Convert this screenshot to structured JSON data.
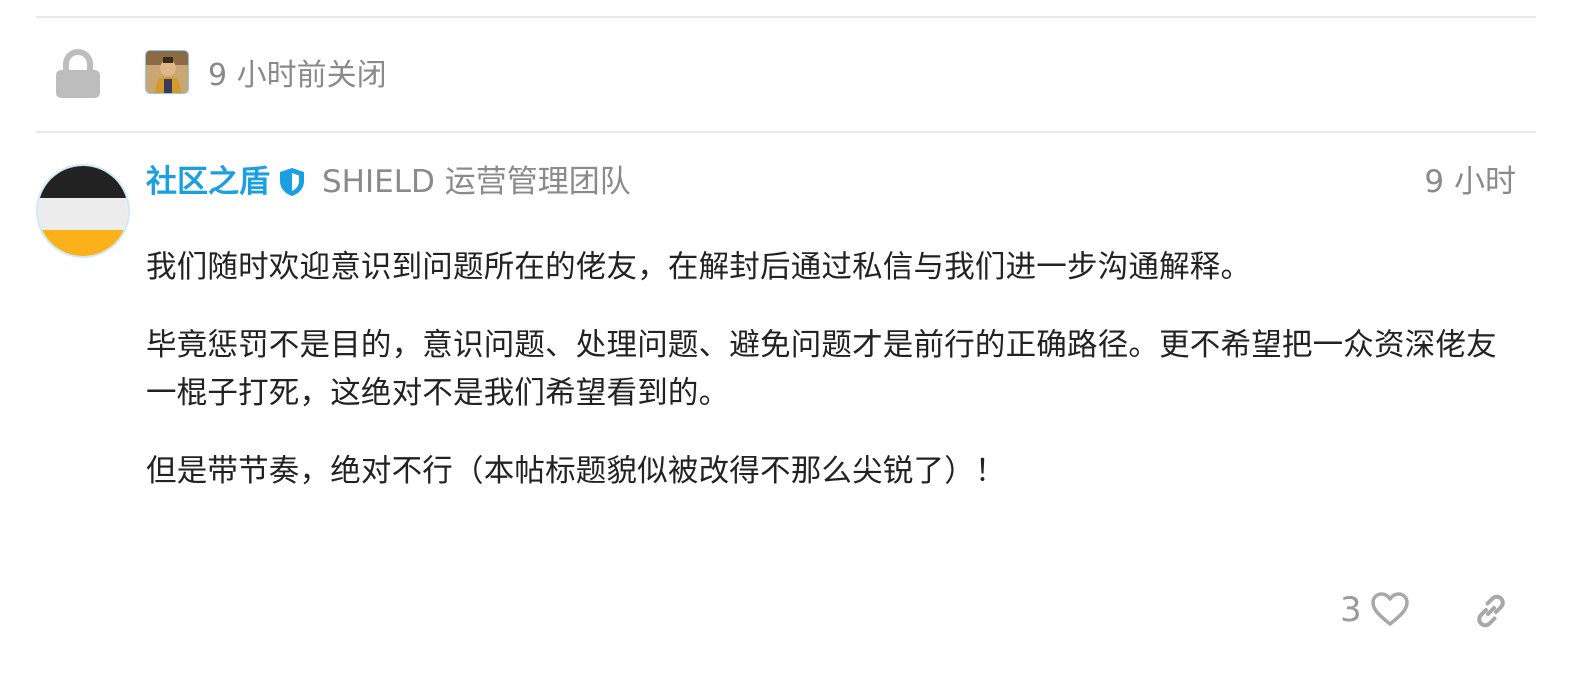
{
  "closed_notice": {
    "icon": "lock-icon",
    "avatar": "moderator-avatar",
    "text": "9 小时前关闭"
  },
  "post": {
    "author": {
      "name": "社区之盾",
      "badge_icon": "shield-icon",
      "group": "SHIELD 运营管理团队",
      "name_color": "#1a9fe0"
    },
    "time": "9 小时",
    "paragraphs": [
      "我们随时欢迎意识到问题所在的佬友，在解封后通过私信与我们进一步沟通解释。",
      "毕竟惩罚不是目的，意识问题、处理问题、避免问题才是前行的正确路径。更不希望把一众资深佬友一棍子打死，这绝对不是我们希望看到的。",
      "但是带节奏，绝对不行（本帖标题貌似被改得不那么尖锐了）！"
    ],
    "actions": {
      "like_count": "3",
      "like_icon": "heart-icon",
      "link_icon": "link-icon"
    }
  }
}
